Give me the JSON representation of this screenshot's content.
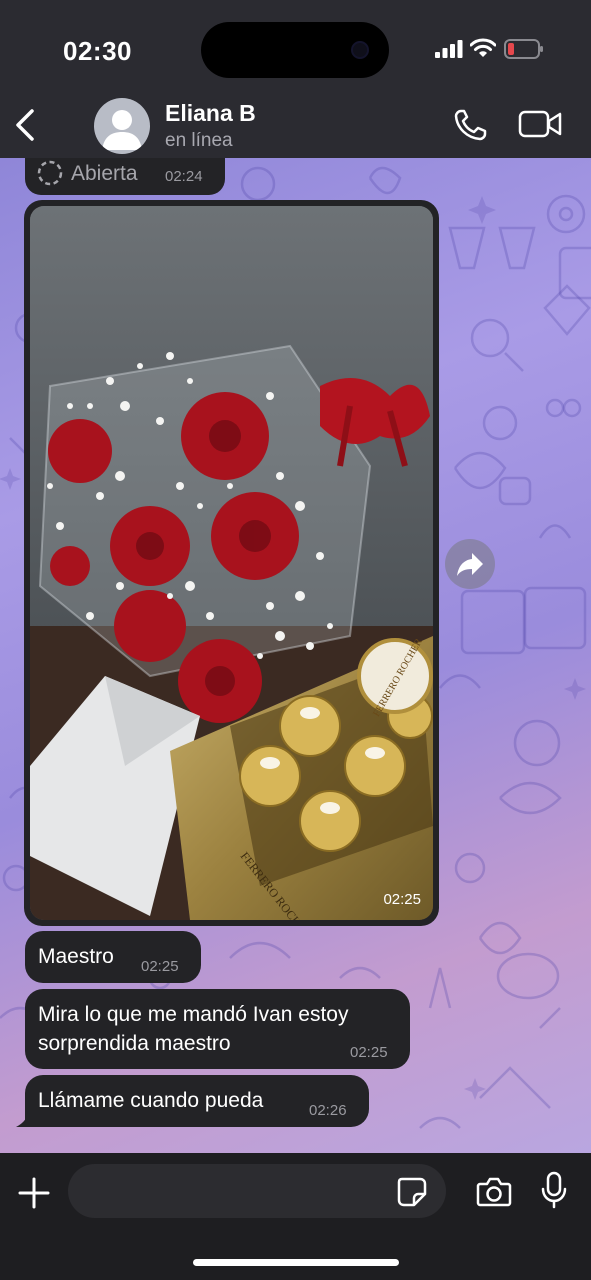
{
  "status_bar": {
    "time": "02:30"
  },
  "header": {
    "back_icon": "chevron-left-icon",
    "contact_name": "Eliana B",
    "contact_status": "en línea",
    "call_icon": "phone-icon",
    "video_icon": "video-camera-icon"
  },
  "messages": [
    {
      "type": "view-once",
      "label": "Abierta",
      "time": "02:24"
    },
    {
      "type": "photo",
      "time": "02:25",
      "photo_text": [
        "FERRERO ROCHER",
        "FERRERO ROCHER"
      ]
    },
    {
      "type": "text",
      "text": "Maestro",
      "time": "02:25"
    },
    {
      "type": "text",
      "text": "Mira lo que me mandó Ivan estoy sorprendida maestro",
      "time": "02:25"
    },
    {
      "type": "text",
      "text": "Llámame cuando pueda",
      "time": "02:26"
    }
  ],
  "input_bar": {
    "placeholder": "",
    "plus_icon": "plus-icon",
    "sticker_icon": "sticker-icon",
    "camera_icon": "camera-icon",
    "mic_icon": "microphone-icon"
  },
  "colors": {
    "bubble": "#232326",
    "header": "#2b2b31",
    "wallpaper_start": "#8f86d8",
    "wallpaper_end": "#c39ccf",
    "battery_low": "#e5484d"
  }
}
